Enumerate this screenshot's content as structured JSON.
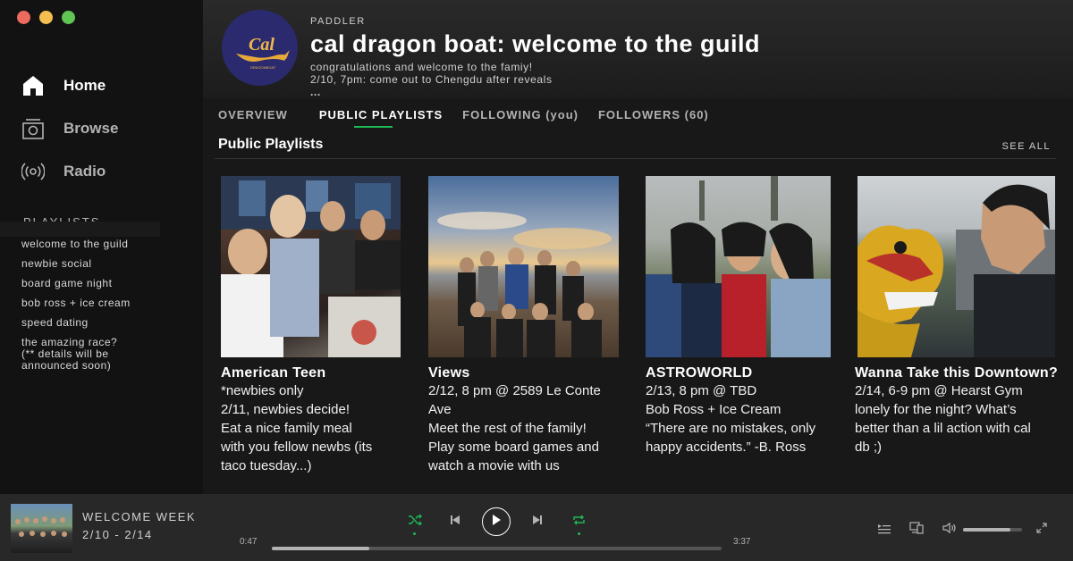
{
  "sidebar": {
    "nav": [
      {
        "label": "Home",
        "icon": "home-icon",
        "active": true
      },
      {
        "label": "Browse",
        "icon": "browse-icon",
        "active": false
      },
      {
        "label": "Radio",
        "icon": "radio-icon",
        "active": false
      }
    ],
    "playlists_heading": "PLAYLISTS",
    "playlists": [
      "welcome to the guild",
      "newbie social",
      "board game night",
      "bob ross + ice cream",
      "speed dating",
      "the amazing race?\n(** details will be\nannounced soon)"
    ]
  },
  "header": {
    "kind": "PADDLER",
    "title": "cal dragon boat: welcome to the guild",
    "desc_line1": "congratulations and welcome to the famiy!",
    "desc_line2": "2/10, 7pm: come out to Chengdu after reveals",
    "desc_more": "...",
    "avatar_text": "Cal",
    "avatar_subtext": "DRAGONBOAT"
  },
  "tabs": [
    {
      "label": "OVERVIEW",
      "active": false
    },
    {
      "label": "PUBLIC PLAYLISTS",
      "active": true
    },
    {
      "label": "FOLLOWING (you)",
      "active": false
    },
    {
      "label": "FOLLOWERS (60)",
      "active": false
    }
  ],
  "section": {
    "title": "Public Playlists",
    "see_all": "SEE ALL"
  },
  "cards": [
    {
      "title": "American Teen",
      "desc": "*newbies only\n2/11, newbies decide!\n Eat a nice family meal\nwith you fellow newbs (its\ntaco tuesday...)"
    },
    {
      "title": "Views",
      "desc": "2/12,  8 pm @ 2589 Le Conte Ave\nMeet the rest of the family!\nPlay some board games and\nwatch a movie with us"
    },
    {
      "title": "ASTROWORLD",
      "desc": "2/13, 8 pm @ TBD\nBob Ross + Ice Cream\n“There are no mistakes, only\nhappy accidents.” -B. Ross"
    },
    {
      "title": "Wanna Take this Downtown?",
      "desc": "2/14, 6-9 pm @ Hearst Gym\nlonely for the night? What’s\nbetter than a lil action with cal\ndb ;)"
    }
  ],
  "player": {
    "track": "WELCOME WEEK",
    "artist": "2/10 - 2/14",
    "elapsed": "0:47",
    "duration": "3:37",
    "progress": 0.217,
    "volume": 0.8,
    "accent": "#1db954"
  }
}
